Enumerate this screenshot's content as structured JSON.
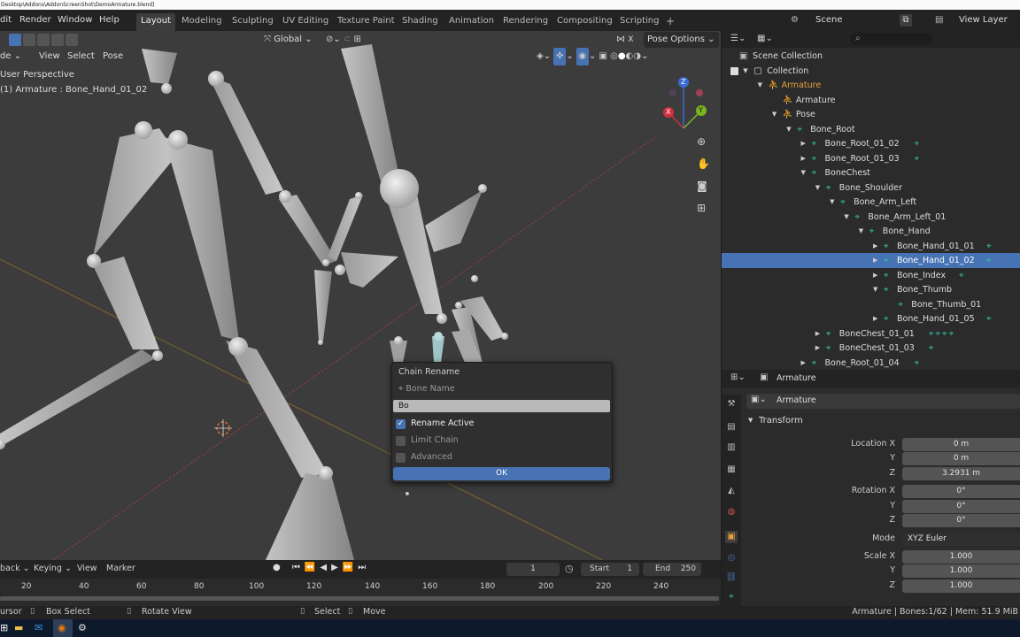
{
  "title_bar": {
    "path": "Desktop\\Addons\\AddonScreenShot\\DemoArmature.blend]"
  },
  "top_menu": {
    "items": [
      "dit",
      "Render",
      "Window",
      "Help"
    ]
  },
  "workspaces": {
    "active": "Layout",
    "items": [
      "Layout",
      "Modeling",
      "Sculpting",
      "UV Editing",
      "Texture Paint",
      "Shading",
      "Animation",
      "Rendering",
      "Compositing",
      "Scripting"
    ],
    "add": "+"
  },
  "scene": {
    "label": "Scene",
    "view_layer": "View Layer"
  },
  "viewport": {
    "header": {
      "orientation": "Global",
      "pose_options": "Pose Options",
      "mode_partial": "de",
      "menus": [
        "View",
        "Select",
        "Pose"
      ]
    },
    "info": {
      "perspective": "User Perspective",
      "object": "(1) Armature : Bone_Hand_01_02"
    },
    "gizmo": {
      "z": "Z",
      "y": "Y",
      "x": "X"
    }
  },
  "popup": {
    "title": "Chain Rename",
    "field_label": "Bone Name",
    "field_value": "Bo",
    "options": [
      {
        "label": "Rename Active",
        "checked": true
      },
      {
        "label": "Limit Chain",
        "checked": false
      },
      {
        "label": "Advanced",
        "checked": false
      }
    ],
    "ok": "OK"
  },
  "outliner": {
    "rows": [
      {
        "label": "Scene Collection",
        "depth": 0,
        "icon": "",
        "arrow": "",
        "selected": false,
        "extra": ""
      },
      {
        "label": "Collection",
        "depth": 1,
        "icon": "",
        "arrow": "▼",
        "selected": false,
        "extra": ""
      },
      {
        "label": "Armature",
        "depth": 2,
        "icon": "",
        "arrow": "▼",
        "selected": false,
        "extra": ""
      },
      {
        "label": "Armature",
        "depth": 3,
        "icon": "",
        "arrow": "",
        "selected": false,
        "extra": ""
      },
      {
        "label": "Pose",
        "depth": 3,
        "icon": "",
        "arrow": "▼",
        "selected": false,
        "extra": ""
      },
      {
        "label": "Bone_Root",
        "depth": 4,
        "icon": "bone",
        "arrow": "▼",
        "selected": false,
        "extra": ""
      },
      {
        "label": "Bone_Root_01_02",
        "depth": 5,
        "icon": "bone",
        "arrow": "▶",
        "selected": false,
        "extra": "bone"
      },
      {
        "label": "Bone_Root_01_03",
        "depth": 5,
        "icon": "bone",
        "arrow": "▶",
        "selected": false,
        "extra": "bone"
      },
      {
        "label": "BoneChest",
        "depth": 5,
        "icon": "bone",
        "arrow": "▼",
        "selected": false,
        "extra": ""
      },
      {
        "label": "Bone_Shoulder",
        "depth": 6,
        "icon": "bone",
        "arrow": "▼",
        "selected": false,
        "extra": ""
      },
      {
        "label": "Bone_Arm_Left",
        "depth": 7,
        "icon": "bone",
        "arrow": "▼",
        "selected": false,
        "extra": ""
      },
      {
        "label": "Bone_Arm_Left_01",
        "depth": 8,
        "icon": "bone",
        "arrow": "▼",
        "selected": false,
        "extra": ""
      },
      {
        "label": "Bone_Hand",
        "depth": 9,
        "icon": "bone",
        "arrow": "▼",
        "selected": false,
        "extra": ""
      },
      {
        "label": "Bone_Hand_01_01",
        "depth": 10,
        "icon": "bone",
        "arrow": "▶",
        "selected": false,
        "extra": "bone"
      },
      {
        "label": "Bone_Hand_01_02",
        "depth": 10,
        "icon": "bone",
        "arrow": "▶",
        "selected": true,
        "extra": "bone"
      },
      {
        "label": "Bone_Index",
        "depth": 10,
        "icon": "bone",
        "arrow": "▶",
        "selected": false,
        "extra": "bone"
      },
      {
        "label": "Bone_Thumb",
        "depth": 10,
        "icon": "bone",
        "arrow": "▼",
        "selected": false,
        "extra": ""
      },
      {
        "label": "Bone_Thumb_01",
        "depth": 11,
        "icon": "bone",
        "arrow": "",
        "selected": false,
        "extra": ""
      },
      {
        "label": "Bone_Hand_01_05",
        "depth": 10,
        "icon": "bone",
        "arrow": "▶",
        "selected": false,
        "extra": "bone"
      },
      {
        "label": "BoneChest_01_01",
        "depth": 6,
        "icon": "bone",
        "arrow": "▶",
        "selected": false,
        "extra": "bones"
      },
      {
        "label": "BoneChest_01_03",
        "depth": 6,
        "icon": "bone",
        "arrow": "▶",
        "selected": false,
        "extra": "bone"
      },
      {
        "label": "Bone_Root_01_04",
        "depth": 5,
        "icon": "bone",
        "arrow": "▶",
        "selected": false,
        "extra": "bone"
      }
    ]
  },
  "properties": {
    "header": "Armature",
    "data_name": "Armature",
    "panel": "Transform",
    "location": {
      "label": "Location X",
      "x": "0 m",
      "y": "0 m",
      "z": "3.2931 m"
    },
    "rotation": {
      "label": "Rotation X",
      "x": "0°",
      "y": "0°",
      "z": "0°"
    },
    "mode": {
      "label": "Mode",
      "value": "XYZ Euler"
    },
    "scale": {
      "label": "Scale X",
      "x": "1.000",
      "y": "1.000",
      "z": "1.000"
    },
    "axis": {
      "y": "Y",
      "z": "Z"
    }
  },
  "timeline": {
    "menus": [
      "back",
      "Keying",
      "View",
      "Marker"
    ],
    "current_frame": "1",
    "start_label": "Start",
    "start": "1",
    "end_label": "End",
    "end": "250",
    "ruler": [
      "20",
      "40",
      "60",
      "80",
      "100",
      "120",
      "140",
      "160",
      "180",
      "200",
      "220",
      "240"
    ]
  },
  "status": {
    "left": [
      "ursor",
      "Box Select",
      "Rotate View",
      "Select",
      "Move"
    ],
    "right": "Armature | Bones:1/62 | Mem: 51.9 MiB"
  },
  "colors": {
    "accent": "#4772b3",
    "bone_icon": "#34c2a6",
    "armature_text": "#e8a23b"
  }
}
